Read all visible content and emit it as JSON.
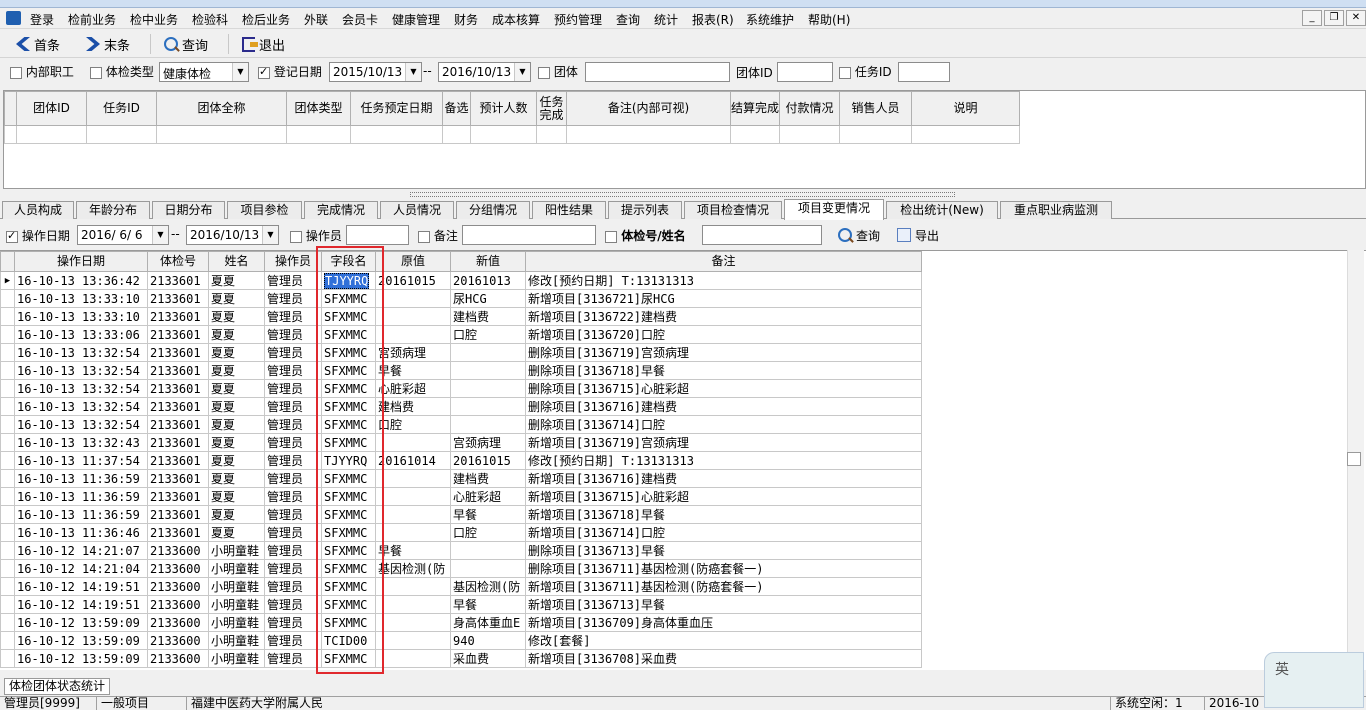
{
  "menu": [
    "登录",
    "检前业务",
    "检中业务",
    "检验科",
    "检后业务",
    "外联",
    "会员卡",
    "健康管理",
    "财务",
    "成本核算",
    "预约管理",
    "查询",
    "统计",
    "报表(R)",
    "系统维护",
    "帮助(H)"
  ],
  "toolbar": {
    "first": "首条",
    "last": "末条",
    "query": "查询",
    "exit": "退出"
  },
  "filter1": {
    "internal_staff": "内部职工",
    "exam_type_label": "体检类型",
    "exam_type_value": "健康体检",
    "reg_date_label": "登记日期",
    "date_from": "2015/10/13",
    "sep": "--",
    "date_to": "2016/10/13",
    "group_label": "团体",
    "group_id_label": "团体ID",
    "task_id_label": "任务ID"
  },
  "grid1_headers": [
    "团体ID",
    "任务ID",
    "团体全称",
    "团体类型",
    "任务预定日期",
    "备选",
    "预计人数",
    "任务完成",
    "备注(内部可视)",
    "结算完成",
    "付款情况",
    "销售人员",
    "说明"
  ],
  "tabs": [
    "人员构成",
    "年龄分布",
    "日期分布",
    "项目参检",
    "完成情况",
    "人员情况",
    "分组情况",
    "阳性结果",
    "提示列表",
    "项目检查情况",
    "项目变更情况",
    "检出统计(New)",
    "重点职业病监测"
  ],
  "filter2": {
    "op_date_label": "操作日期",
    "date_from": "2016/ 6/ 6",
    "sep": "--",
    "date_to": "2016/10/13",
    "operator_label": "操作员",
    "remark_label": "备注",
    "exam_no_label": "体检号/姓名",
    "query": "查询",
    "export": "导出"
  },
  "grid2_headers": [
    "操作日期",
    "体检号",
    "姓名",
    "操作员",
    "字段名",
    "原值",
    "新值",
    "备注"
  ],
  "grid2_rows": [
    [
      "16-10-13 13:36:42",
      "2133601",
      "夏夏",
      "管理员",
      "TJYYRQ",
      "20161015",
      "20161013",
      "修改[预约日期] T:13131313"
    ],
    [
      "16-10-13 13:33:10",
      "2133601",
      "夏夏",
      "管理员",
      "SFXMMC",
      "",
      "尿HCG",
      "新增项目[3136721]尿HCG"
    ],
    [
      "16-10-13 13:33:10",
      "2133601",
      "夏夏",
      "管理员",
      "SFXMMC",
      "",
      "建档费",
      "新增项目[3136722]建档费"
    ],
    [
      "16-10-13 13:33:06",
      "2133601",
      "夏夏",
      "管理员",
      "SFXMMC",
      "",
      "口腔",
      "新增项目[3136720]口腔"
    ],
    [
      "16-10-13 13:32:54",
      "2133601",
      "夏夏",
      "管理员",
      "SFXMMC",
      "宫颈病理",
      "",
      "删除项目[3136719]宫颈病理"
    ],
    [
      "16-10-13 13:32:54",
      "2133601",
      "夏夏",
      "管理员",
      "SFXMMC",
      "早餐",
      "",
      "删除项目[3136718]早餐"
    ],
    [
      "16-10-13 13:32:54",
      "2133601",
      "夏夏",
      "管理员",
      "SFXMMC",
      "心脏彩超",
      "",
      "删除项目[3136715]心脏彩超"
    ],
    [
      "16-10-13 13:32:54",
      "2133601",
      "夏夏",
      "管理员",
      "SFXMMC",
      "建档费",
      "",
      "删除项目[3136716]建档费"
    ],
    [
      "16-10-13 13:32:54",
      "2133601",
      "夏夏",
      "管理员",
      "SFXMMC",
      "口腔",
      "",
      "删除项目[3136714]口腔"
    ],
    [
      "16-10-13 13:32:43",
      "2133601",
      "夏夏",
      "管理员",
      "SFXMMC",
      "",
      "宫颈病理",
      "新增项目[3136719]宫颈病理"
    ],
    [
      "16-10-13 11:37:54",
      "2133601",
      "夏夏",
      "管理员",
      "TJYYRQ",
      "20161014",
      "20161015",
      "修改[预约日期] T:13131313"
    ],
    [
      "16-10-13 11:36:59",
      "2133601",
      "夏夏",
      "管理员",
      "SFXMMC",
      "",
      "建档费",
      "新增项目[3136716]建档费"
    ],
    [
      "16-10-13 11:36:59",
      "2133601",
      "夏夏",
      "管理员",
      "SFXMMC",
      "",
      "心脏彩超",
      "新增项目[3136715]心脏彩超"
    ],
    [
      "16-10-13 11:36:59",
      "2133601",
      "夏夏",
      "管理员",
      "SFXMMC",
      "",
      "早餐",
      "新增项目[3136718]早餐"
    ],
    [
      "16-10-13 11:36:46",
      "2133601",
      "夏夏",
      "管理员",
      "SFXMMC",
      "",
      "口腔",
      "新增项目[3136714]口腔"
    ],
    [
      "16-10-12 14:21:07",
      "2133600",
      "小明童鞋",
      "管理员",
      "SFXMMC",
      "早餐",
      "",
      "删除项目[3136713]早餐"
    ],
    [
      "16-10-12 14:21:04",
      "2133600",
      "小明童鞋",
      "管理员",
      "SFXMMC",
      "基因检测(防",
      "",
      "删除项目[3136711]基因检测(防癌套餐一)"
    ],
    [
      "16-10-12 14:19:51",
      "2133600",
      "小明童鞋",
      "管理员",
      "SFXMMC",
      "",
      "基因检测(防",
      "新增项目[3136711]基因检测(防癌套餐一)"
    ],
    [
      "16-10-12 14:19:51",
      "2133600",
      "小明童鞋",
      "管理员",
      "SFXMMC",
      "",
      "早餐",
      "新增项目[3136713]早餐"
    ],
    [
      "16-10-12 13:59:09",
      "2133600",
      "小明童鞋",
      "管理员",
      "SFXMMC",
      "",
      "身高体重血E",
      "新增项目[3136709]身高体重血压"
    ],
    [
      "16-10-12 13:59:09",
      "2133600",
      "小明童鞋",
      "管理员",
      "TCID00",
      "",
      "940",
      "修改[套餐]"
    ],
    [
      "16-10-12 13:59:09",
      "2133600",
      "小明童鞋",
      "管理员",
      "SFXMMC",
      "",
      "采血费",
      "新增项目[3136708]采血费"
    ]
  ],
  "bottom_tab": "体检团体状态统计",
  "status": {
    "user": "管理员[9999]",
    "mode": "一般项目",
    "org": "福建中医药大学附属人民",
    "mem": "系统空闲：1",
    "date": "2016-10"
  },
  "ime_label": "英"
}
